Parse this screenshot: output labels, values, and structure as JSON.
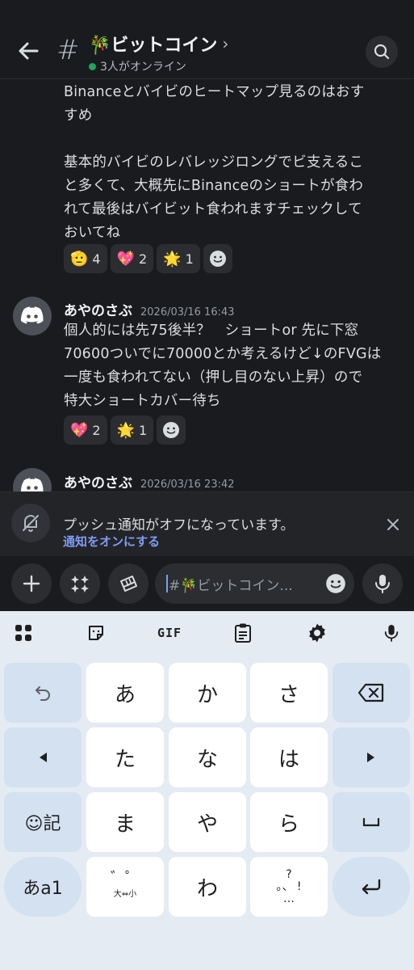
{
  "header": {
    "channel_title": "🎋ビットコイン",
    "online_status": "3人がオンライン"
  },
  "messages": {
    "first_text_lines": [
      "Binanceとバイビのヒートマップ見るのはおす",
      "すめ",
      "",
      "基本的バイビのレバレッジロングでビ支えるこ",
      "と多くて、大概先にBinanceのショートが食わ",
      "れて最後はバイビット食われますチェックして",
      "おいてね"
    ],
    "first_reactions": [
      {
        "emoji": "🫡",
        "count": "4"
      },
      {
        "emoji": "💖",
        "count": "2"
      },
      {
        "emoji": "🌟",
        "count": "1"
      }
    ],
    "second": {
      "author": "あやのさぶ",
      "timestamp": "2026/03/16 16:43",
      "lines": [
        "個人的には先75後半？　ショートor 先に下窓",
        "70600ついでに70000とか考えるけど↓のFVGは",
        "一度も食われてない（押し目のない上昇）ので",
        "特大ショートカバー待ち"
      ],
      "reactions": [
        {
          "emoji": "💖",
          "count": "2"
        },
        {
          "emoji": "🌟",
          "count": "1"
        }
      ]
    },
    "third": {
      "author": "あやのさぶ",
      "timestamp": "2026/03/16 23:42"
    }
  },
  "notice": {
    "title": "プッシュ通知がオフになっています。",
    "link": "通知をオンにする"
  },
  "composer": {
    "placeholder": "#🎋ビットコイン..."
  },
  "keyboard": {
    "gif_label": "GIF",
    "rows": [
      [
        "↶",
        "あ",
        "か",
        "さ",
        "⌫"
      ],
      [
        "◀",
        "た",
        "な",
        "は",
        "▶"
      ],
      [
        "☺記",
        "ま",
        "や",
        "ら",
        "␣"
      ],
      [
        "あa1",
        "゛゜",
        "わ",
        "、。?!",
        "↵"
      ]
    ],
    "dakuten_sub": "大⇔小",
    "punct_top": "?",
    "punct_mid": "。、 !",
    "punct_bot": "…"
  }
}
